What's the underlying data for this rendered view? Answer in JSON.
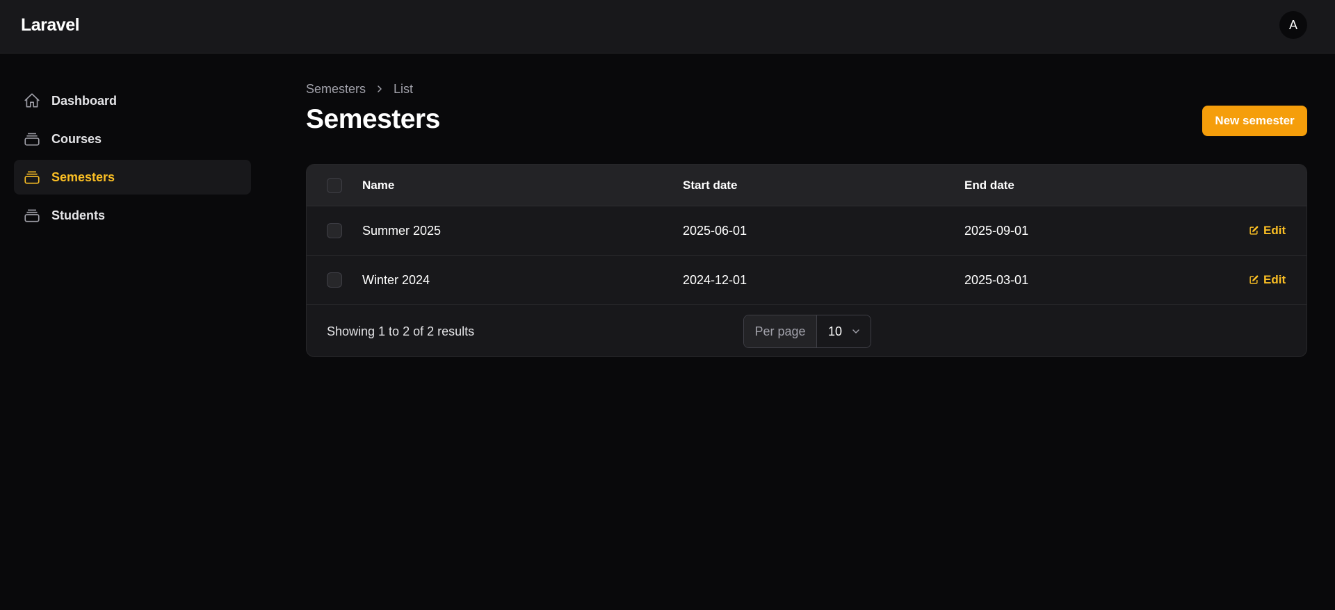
{
  "app": {
    "brand": "Laravel",
    "user_initial": "A"
  },
  "sidebar": {
    "items": [
      {
        "label": "Dashboard",
        "icon": "home-icon",
        "active": false
      },
      {
        "label": "Courses",
        "icon": "rectangle-stack-icon",
        "active": false
      },
      {
        "label": "Semesters",
        "icon": "rectangle-stack-icon",
        "active": true
      },
      {
        "label": "Students",
        "icon": "rectangle-stack-icon",
        "active": false
      }
    ]
  },
  "breadcrumb": {
    "items": [
      "Semesters",
      "List"
    ]
  },
  "page": {
    "title": "Semesters",
    "new_button_label": "New semester"
  },
  "table": {
    "columns": [
      "Name",
      "Start date",
      "End date"
    ],
    "rows": [
      {
        "name": "Summer 2025",
        "start_date": "2025-06-01",
        "end_date": "2025-09-01",
        "action": "Edit"
      },
      {
        "name": "Winter 2024",
        "start_date": "2024-12-01",
        "end_date": "2025-03-01",
        "action": "Edit"
      }
    ],
    "footer": {
      "summary": "Showing 1 to 2 of 2 results",
      "per_page_label": "Per page",
      "per_page_value": "10"
    }
  },
  "colors": {
    "accent": "#f59e0b",
    "accent_text": "#fbbf24",
    "background": "#09090b",
    "surface": "#18181b"
  }
}
